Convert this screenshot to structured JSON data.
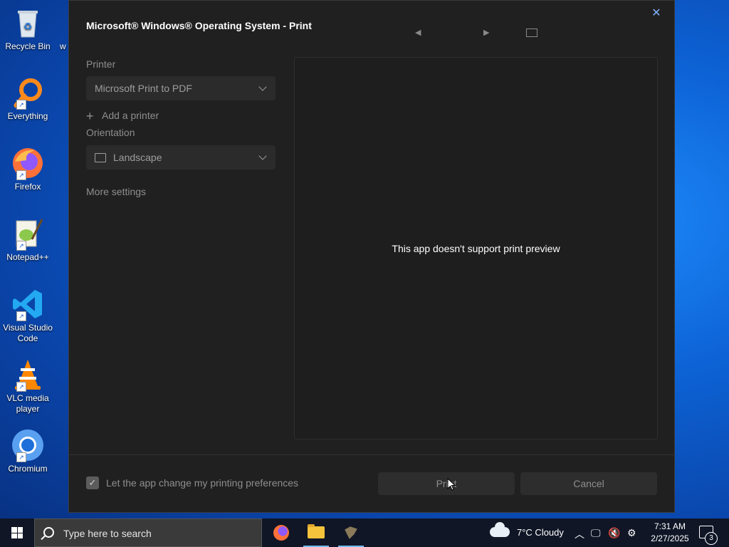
{
  "desktop": {
    "icons": [
      {
        "label": "Recycle Bin"
      },
      {
        "label": "Everything"
      },
      {
        "label": "Firefox"
      },
      {
        "label": "Notepad++"
      },
      {
        "label": "Visual Studio Code"
      },
      {
        "label": "VLC media player"
      },
      {
        "label": "Chromium"
      }
    ],
    "peek_label": "w"
  },
  "dialog": {
    "title": "Microsoft® Windows® Operating System - Print",
    "printer_label": "Printer",
    "printer_value": "Microsoft Print to PDF",
    "add_printer": "Add a printer",
    "orientation_label": "Orientation",
    "orientation_value": "Landscape",
    "more_settings": "More settings",
    "preview_message": "This app doesn't support print preview",
    "checkbox_label": "Let the app change my printing preferences",
    "print_button": "Print",
    "cancel_button": "Cancel"
  },
  "taskbar": {
    "search_placeholder": "Type here to search",
    "weather": "7°C  Cloudy",
    "time": "7:31 AM",
    "date": "2/27/2025",
    "notification_count": "3"
  },
  "colors": {
    "dialog_bg": "#202020",
    "accent": "#76b9ed",
    "taskbar_bg": "#101626"
  }
}
